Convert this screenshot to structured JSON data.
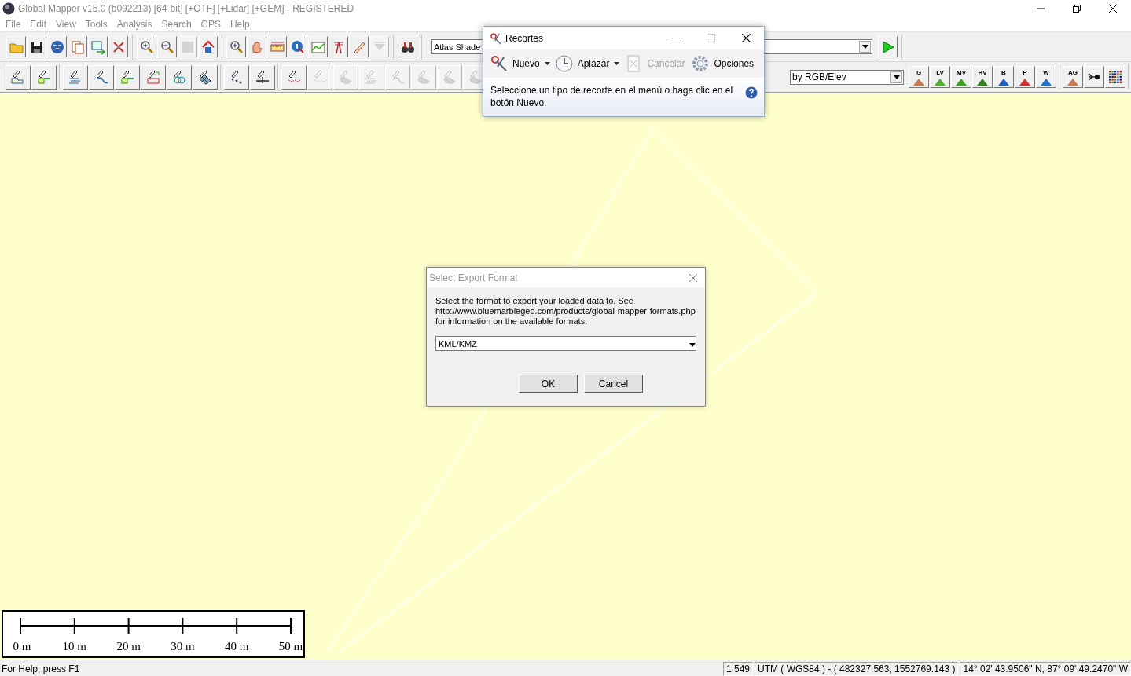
{
  "window": {
    "title": "Global Mapper v15.0 (b092213) [64-bit] [+OTF] [+Lidar] [+GEM] - REGISTERED"
  },
  "menu": [
    "File",
    "Edit",
    "View",
    "Tools",
    "Analysis",
    "Search",
    "GPS",
    "Help"
  ],
  "toolbar_1": {
    "groups": [
      [
        {
          "kind": "folder",
          "disabled": false
        },
        {
          "kind": "disk",
          "disabled": false
        },
        {
          "kind": "globe",
          "disabled": false
        },
        {
          "kind": "pages",
          "disabled": false
        },
        {
          "kind": "export",
          "disabled": false
        },
        {
          "kind": "tools",
          "disabled": false
        }
      ],
      [
        {
          "kind": "zoom-in",
          "disabled": false
        },
        {
          "kind": "zoom-out",
          "disabled": false
        },
        {
          "kind": "square",
          "disabled": true
        },
        {
          "kind": "home",
          "disabled": false
        }
      ],
      [
        {
          "kind": "zoom-box",
          "disabled": false
        },
        {
          "kind": "hand",
          "disabled": false
        },
        {
          "kind": "ruler",
          "disabled": false
        },
        {
          "kind": "info",
          "disabled": false
        },
        {
          "kind": "chart",
          "disabled": false
        },
        {
          "kind": "tower",
          "disabled": false
        },
        {
          "kind": "pencil",
          "disabled": false
        },
        {
          "kind": "funnel",
          "disabled": true
        }
      ],
      [
        {
          "kind": "binoculars",
          "disabled": false
        }
      ]
    ],
    "combo": {
      "value": "Atlas Shade"
    },
    "run_button": {
      "kind": "play",
      "disabled": false
    }
  },
  "toolbar_2": {
    "groups": [
      [
        {
          "kind": "draw-area",
          "disabled": false
        },
        {
          "kind": "draw-rect",
          "disabled": false
        }
      ],
      [
        {
          "kind": "draw-lines",
          "disabled": false
        },
        {
          "kind": "draw-curve",
          "disabled": false
        },
        {
          "kind": "draw-rect",
          "disabled": false
        },
        {
          "kind": "draw-code",
          "disabled": false
        },
        {
          "kind": "draw-circles",
          "disabled": false
        },
        {
          "kind": "draw-grid",
          "disabled": false
        }
      ],
      [
        {
          "kind": "draw-points",
          "disabled": false
        },
        {
          "kind": "draw-cross",
          "disabled": false
        }
      ],
      [
        {
          "kind": "draw-path",
          "disabled": false
        },
        {
          "kind": "draw-path",
          "disabled": true
        },
        {
          "kind": "draw-blob",
          "disabled": true
        },
        {
          "kind": "draw-lines",
          "disabled": true
        },
        {
          "kind": "draw-curve",
          "disabled": true
        },
        {
          "kind": "draw-blob",
          "disabled": true
        },
        {
          "kind": "draw-blob",
          "disabled": true
        },
        {
          "kind": "draw-blob",
          "disabled": true
        }
      ]
    ],
    "combo": {
      "value": "by RGB/Elev"
    },
    "right_groups": [
      [
        {
          "kind": "letter",
          "label": "G",
          "color": "#c87850",
          "disabled": false
        },
        {
          "kind": "letter",
          "label": "LV",
          "color": "#50b030",
          "disabled": false
        },
        {
          "kind": "letter",
          "label": "MV",
          "color": "#40a020",
          "disabled": false
        },
        {
          "kind": "letter",
          "label": "HV",
          "color": "#308020",
          "disabled": false
        },
        {
          "kind": "letter",
          "label": "B",
          "color": "#2060c0",
          "disabled": false
        },
        {
          "kind": "letter",
          "label": "P",
          "color": "#d03030",
          "disabled": false
        },
        {
          "kind": "letter",
          "label": "W",
          "color": "#2070d0",
          "disabled": false
        }
      ],
      [
        {
          "kind": "letter",
          "label": "AG",
          "color": "#c87850",
          "disabled": false
        },
        {
          "kind": "lidar",
          "disabled": false
        },
        {
          "kind": "dot-grid",
          "disabled": false
        }
      ]
    ]
  },
  "scale_bar": {
    "labels": [
      "0 m",
      "10 m",
      "20 m",
      "30 m",
      "40 m",
      "50 m"
    ]
  },
  "status_bar": {
    "help": "For Help, press F1",
    "scale": "1:549",
    "projection": "UTM ( WGS84 ) - ( 482327.563, 1552769.143 )",
    "coordinates": "14° 02' 43.9506\" N, 87° 09' 49.2470\" W"
  },
  "snipping_tool": {
    "title": "Recortes",
    "tools": [
      {
        "kind": "new",
        "label": "Nuevo",
        "dropdown": true,
        "disabled": false
      },
      {
        "kind": "delay",
        "label": "Aplazar",
        "dropdown": true,
        "disabled": false
      },
      {
        "kind": "cancel",
        "label": "Cancelar",
        "dropdown": false,
        "disabled": true
      },
      {
        "kind": "options",
        "label": "Opciones",
        "dropdown": false,
        "disabled": false
      }
    ],
    "message": "Seleccione un tipo de recorte en el menú o haga clic en el botón Nuevo."
  },
  "export_dialog": {
    "title": "Select Export Format",
    "message": "Select the format to export your loaded data to. See http://www.bluemarblegeo.com/products/global-mapper-formats.php for information on the available formats.",
    "format": "KML/KMZ",
    "buttons": [
      "OK",
      "Cancel"
    ]
  }
}
